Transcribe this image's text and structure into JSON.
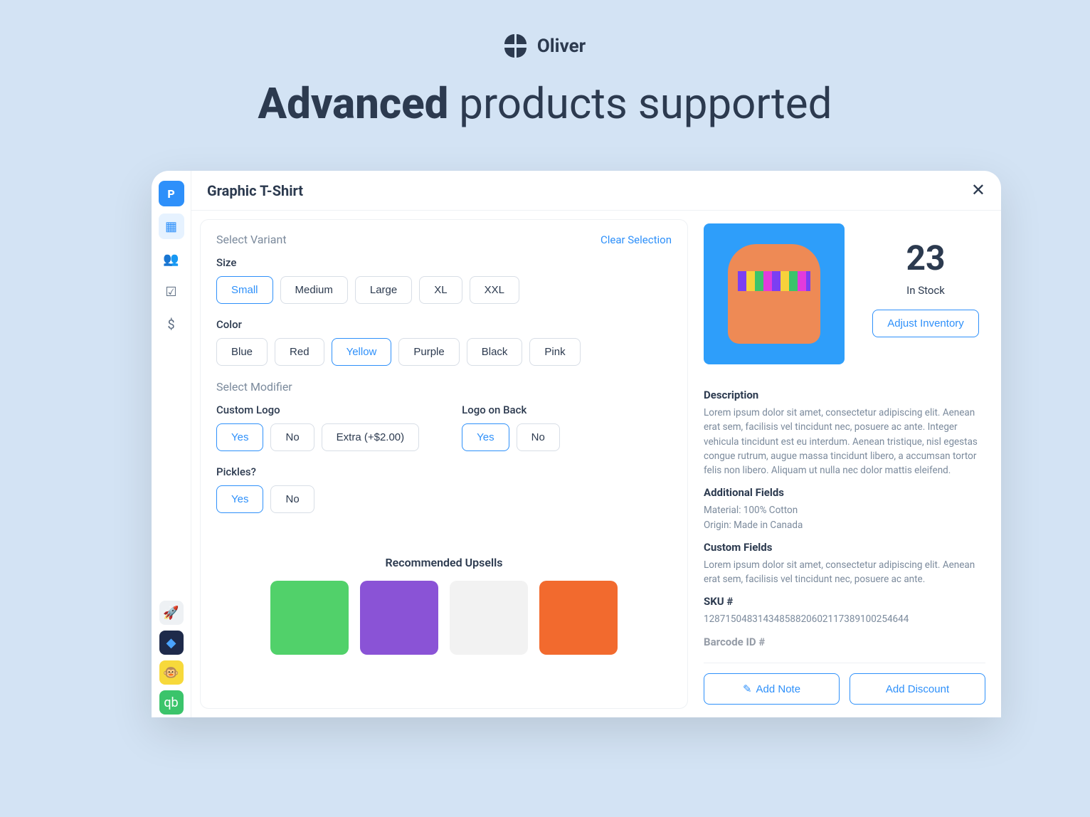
{
  "brand": {
    "name": "Oliver"
  },
  "headline": {
    "bold": "Advanced",
    "rest": " products supported"
  },
  "product": {
    "title": "Graphic T-Shirt"
  },
  "variant": {
    "section_label": "Select Variant",
    "clear_label": "Clear Selection",
    "size_label": "Size",
    "sizes": [
      "Small",
      "Medium",
      "Large",
      "XL",
      "XXL"
    ],
    "size_selected": "Small",
    "color_label": "Color",
    "colors": [
      "Blue",
      "Red",
      "Yellow",
      "Purple",
      "Black",
      "Pink"
    ],
    "color_selected": "Yellow"
  },
  "modifier": {
    "section_label": "Select Modifier",
    "custom_logo": {
      "label": "Custom Logo",
      "options": [
        "Yes",
        "No",
        "Extra (+$2.00)"
      ],
      "selected": "Yes"
    },
    "logo_back": {
      "label": "Logo on Back",
      "options": [
        "Yes",
        "No"
      ],
      "selected": "Yes"
    },
    "pickles": {
      "label": "Pickles?",
      "options": [
        "Yes",
        "No"
      ],
      "selected": "Yes"
    }
  },
  "upsell": {
    "title": "Recommended Upsells",
    "cards": [
      {
        "color": "#51d16a"
      },
      {
        "color": "#8a53d6"
      },
      {
        "color": "#f2f2f2"
      },
      {
        "color": "#f26a2e"
      }
    ]
  },
  "inventory": {
    "count": "23",
    "label": "In Stock",
    "adjust_label": "Adjust Inventory"
  },
  "description": {
    "heading": "Description",
    "body": "Lorem ipsum dolor sit amet, consectetur adipiscing elit. Aenean erat sem, facilisis vel tincidunt nec, posuere ac ante. Integer vehicula tincidunt est eu interdum. Aenean tristique, nisl egestas congue rutrum, augue massa tincidunt libero, a accumsan tortor felis non libero. Aliquam ut nulla nec dolor mattis eleifend."
  },
  "additional": {
    "heading": "Additional Fields",
    "lines": [
      "Material: 100% Cotton",
      "Origin: Made in Canada"
    ]
  },
  "custom": {
    "heading": "Custom Fields",
    "body": "Lorem ipsum dolor sit amet, consectetur adipiscing elit. Aenean erat sem, facilisis vel tincidunt nec, posuere ac ante."
  },
  "sku": {
    "heading": "SKU #",
    "value": "12871504831434858820602117389100254644"
  },
  "barcode": {
    "heading": "Barcode ID #"
  },
  "actions": {
    "add_note": "Add Note",
    "add_discount": "Add Discount"
  },
  "sidebar_apps": [
    {
      "bg": "#eef1f4",
      "fg": "#5b6b80",
      "glyph": "🚀"
    },
    {
      "bg": "#1e2a4a",
      "fg": "#4aa3ff",
      "glyph": "◆"
    },
    {
      "bg": "#f7d93b",
      "fg": "#000",
      "glyph": "🐵"
    },
    {
      "bg": "#3bc46b",
      "fg": "#fff",
      "glyph": "qb"
    }
  ]
}
